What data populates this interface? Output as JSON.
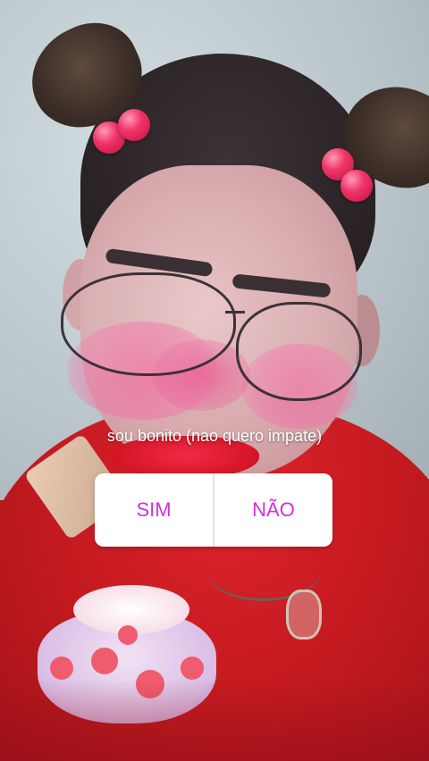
{
  "poll": {
    "question": "sou bonito (nao quero impate)",
    "option_yes": "SIM",
    "option_no": "NÃO",
    "accent_color": "#d62fd9"
  },
  "stickers": {
    "hair_accessory": "pigtails-with-pink-beads",
    "blush": "pink-blush-filter",
    "bottom_sticker": "polka-dot-bag-sticker"
  }
}
